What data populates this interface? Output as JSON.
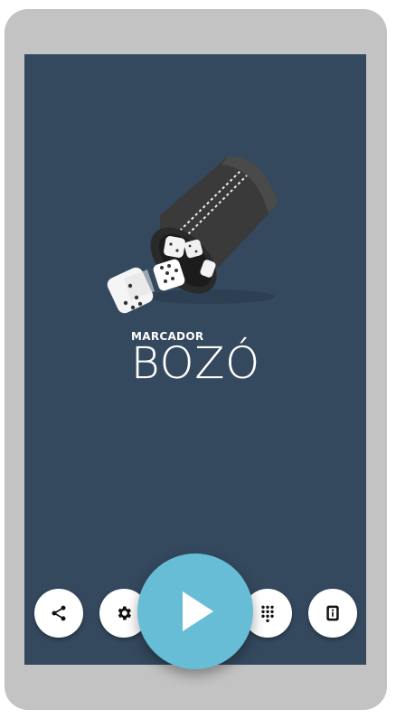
{
  "app": {
    "brand_prefix": "MARCADOR",
    "brand_name": "BOZÓ"
  },
  "colors": {
    "screen_bg": "#34495e",
    "phone_frame": "#c3c3c3",
    "play_button": "#67bdd6",
    "button_bg": "#ffffff"
  },
  "actions": [
    {
      "name": "share",
      "icon": "share-icon"
    },
    {
      "name": "settings",
      "icon": "gear-icon"
    },
    {
      "name": "play",
      "icon": "play-icon"
    },
    {
      "name": "keypad",
      "icon": "dialpad-icon"
    },
    {
      "name": "info",
      "icon": "info-icon"
    }
  ]
}
